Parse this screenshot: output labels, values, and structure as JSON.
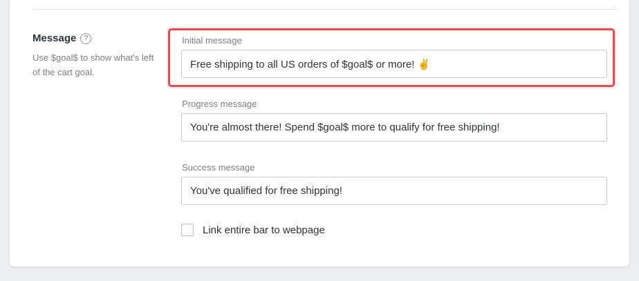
{
  "section": {
    "title": "Message",
    "help_icon": "question-circle-icon",
    "description": "Use $goal$ to show what's left of the cart goal."
  },
  "fields": {
    "initial": {
      "label": "Initial message",
      "value": "Free shipping to all US orders of $goal$ or more! ✌️"
    },
    "progress": {
      "label": "Progress message",
      "value": "You're almost there! Spend $goal$ more to qualify for free shipping!"
    },
    "success": {
      "label": "Success message",
      "value": "You've qualified for free shipping!"
    }
  },
  "link_checkbox": {
    "label": "Link entire bar to webpage",
    "checked": false
  },
  "colors": {
    "highlight": "#ea4a4f",
    "text": "#2e3338",
    "muted": "#7b8088"
  }
}
